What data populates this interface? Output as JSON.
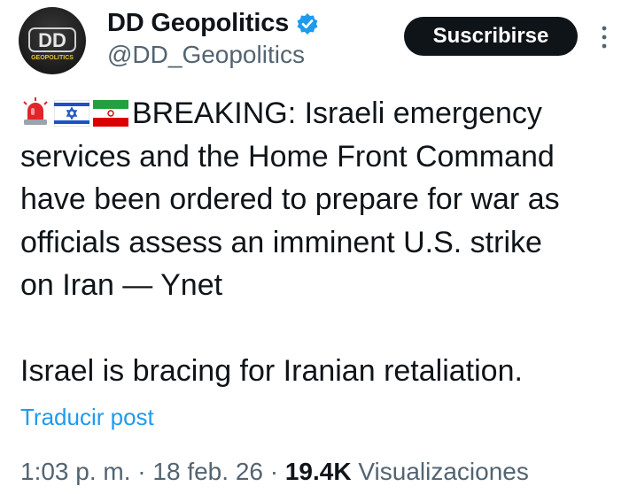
{
  "author": {
    "display_name": "DD Geopolitics",
    "handle": "@DD_Geopolitics",
    "verified": true,
    "avatar_text": "DD",
    "avatar_subtext": "GEOPOLITICS"
  },
  "header": {
    "subscribe_label": "Suscribirse"
  },
  "tweet": {
    "emojis": [
      "rotating-light-icon",
      "israel-flag-icon",
      "iran-flag-icon"
    ],
    "lines": [
      "BREAKING: Israeli emergency",
      "services and the Home Front Command",
      "have been ordered to prepare for war as",
      "officials assess an imminent U.S. strike",
      "on Iran — Ynet",
      "Israel is bracing for Iranian retaliation."
    ]
  },
  "translate_label": "Traducir post",
  "meta": {
    "time": "1:03 p. m.",
    "separator": "·",
    "date": "18 feb. 26",
    "views_count": "19.4K",
    "views_label": "Visualizaciones"
  },
  "colors": {
    "text": "#0f1419",
    "secondary": "#536471",
    "link": "#1d9bf0",
    "verified": "#1d9bf0",
    "button_bg": "#0f1419"
  }
}
